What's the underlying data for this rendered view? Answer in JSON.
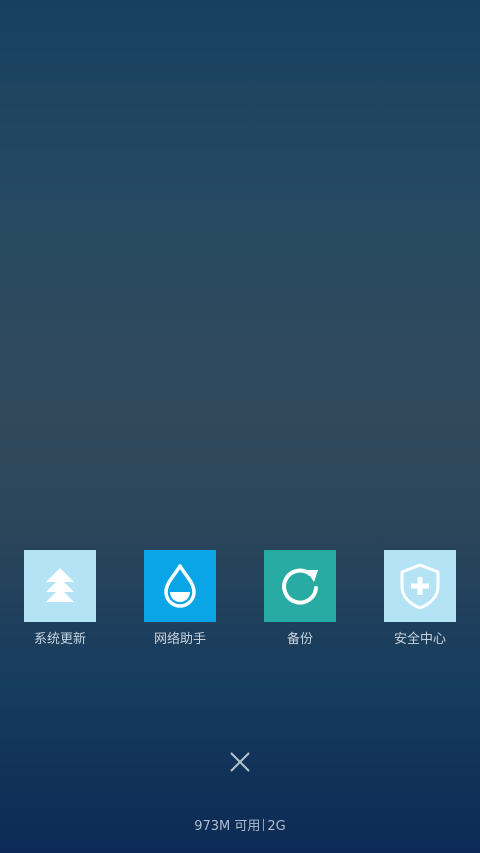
{
  "apps": [
    {
      "label": "系统更新",
      "icon": "system-update-icon",
      "color": "#b3e3f5"
    },
    {
      "label": "网络助手",
      "icon": "network-assistant-icon",
      "color": "#0aa5e6"
    },
    {
      "label": "备份",
      "icon": "backup-icon",
      "color": "#27aba2"
    },
    {
      "label": "安全中心",
      "icon": "security-center-icon",
      "color": "#b3e3f5"
    }
  ],
  "close_icon": "close-icon",
  "memory": {
    "available": "973M 可用",
    "total": "2G"
  }
}
